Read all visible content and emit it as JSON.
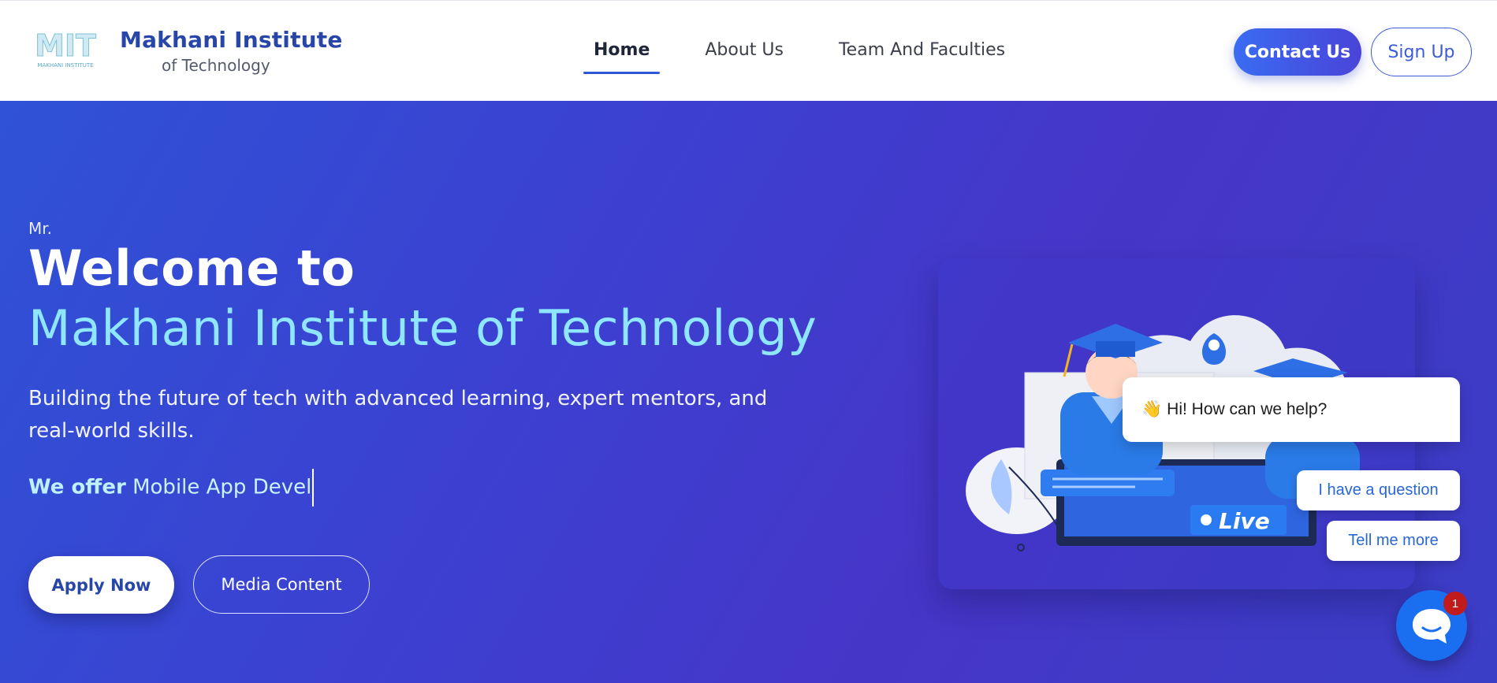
{
  "header": {
    "logo_text": "MIT",
    "logo_caption": "MAKHANI INSTITUTE",
    "brand_name": "Makhani Institute",
    "brand_sub": "of Technology",
    "nav": [
      {
        "label": "Home",
        "active": true
      },
      {
        "label": "About Us",
        "active": false
      },
      {
        "label": "Team And Faculties",
        "active": false
      }
    ],
    "contact_label": "Contact Us",
    "signup_label": "Sign Up"
  },
  "hero": {
    "salutation": "Mr.",
    "title_line1": "Welcome to",
    "title_line2": "Makhani Institute of Technology",
    "description": "Building the future of tech with advanced learning, expert mentors, and real-world skills.",
    "offer_label": "We offer",
    "offer_typed": "Mobile App Devel",
    "apply_label": "Apply Now",
    "media_label": "Media Content",
    "illustration": {
      "icon": "graduates-live-class-illustration",
      "live_label": "Live"
    }
  },
  "chat": {
    "greeting_icon": "waving-hand-icon",
    "greeting": "Hi! How can we help?",
    "quick_replies": [
      "I have a question",
      "Tell me more"
    ],
    "badge_count": "1",
    "launcher_icon": "chat-bubble-icon"
  },
  "colors": {
    "brand": "#2746a8",
    "accent": "#3a6cf2",
    "hero_start": "#2f52d6",
    "hero_end": "#4636c8",
    "title_highlight": "#8fe6ff",
    "chat_blue": "#1a6ef0",
    "badge_red": "#c21b1b"
  }
}
